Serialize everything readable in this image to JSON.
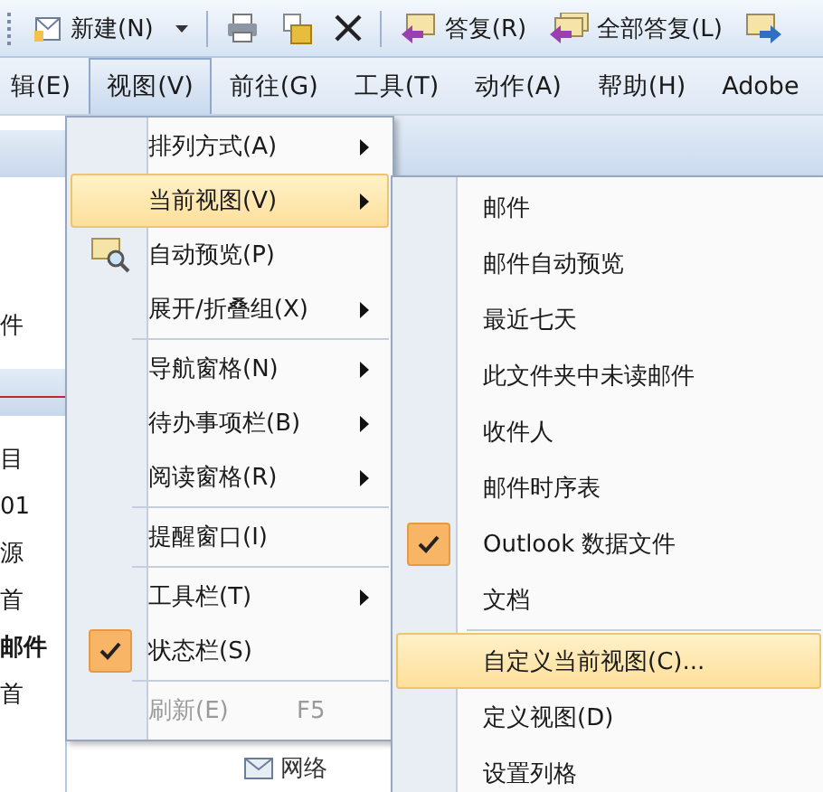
{
  "toolbar": {
    "buttons": [
      {
        "kind": "new",
        "label": "新建(N)"
      },
      {
        "kind": "dropdown"
      },
      {
        "kind": "print"
      },
      {
        "kind": "move"
      },
      {
        "kind": "delete"
      },
      {
        "kind": "reply",
        "label": "答复(R)"
      },
      {
        "kind": "reply_all",
        "label": "全部答复(L)"
      },
      {
        "kind": "forward"
      }
    ]
  },
  "menu_bar": {
    "items": [
      {
        "label": "辑(E)",
        "selected": false
      },
      {
        "label": "视图(V)",
        "selected": true
      },
      {
        "label": "前往(G)",
        "selected": false
      },
      {
        "label": "工具(T)",
        "selected": false
      },
      {
        "label": "动作(A)",
        "selected": false
      },
      {
        "label": "帮助(H)",
        "selected": false
      },
      {
        "label": "Adobe",
        "selected": false
      }
    ]
  },
  "left_pane": {
    "top_items": [
      "件"
    ],
    "items": [
      {
        "label": "目",
        "bold": false
      },
      {
        "label": "01",
        "bold": false
      },
      {
        "label": "源",
        "bold": false
      },
      {
        "label": "首",
        "bold": false
      },
      {
        "label": "邮件",
        "bold": true
      },
      {
        "label": "首",
        "bold": false
      }
    ]
  },
  "background_folder": {
    "label": "网络"
  },
  "view_menu": {
    "items": [
      {
        "kind": "item",
        "label": "排列方式(A)",
        "submenu": true,
        "selected": false,
        "checked": false,
        "disabled": false
      },
      {
        "kind": "item",
        "label": "当前视图(V)",
        "submenu": true,
        "selected": true,
        "checked": false,
        "disabled": false
      },
      {
        "kind": "item",
        "label": "自动预览(P)",
        "submenu": false,
        "selected": false,
        "checked": false,
        "disabled": false,
        "icon": true
      },
      {
        "kind": "item",
        "label": "展开/折叠组(X)",
        "submenu": true,
        "selected": false,
        "checked": false,
        "disabled": false
      },
      {
        "kind": "separator"
      },
      {
        "kind": "item",
        "label": "导航窗格(N)",
        "submenu": true,
        "selected": false,
        "checked": false,
        "disabled": false
      },
      {
        "kind": "item",
        "label": "待办事项栏(B)",
        "submenu": true,
        "selected": false,
        "checked": false,
        "disabled": false
      },
      {
        "kind": "item",
        "label": "阅读窗格(R)",
        "submenu": true,
        "selected": false,
        "checked": false,
        "disabled": false
      },
      {
        "kind": "separator"
      },
      {
        "kind": "item",
        "label": "提醒窗口(I)",
        "submenu": false,
        "selected": false,
        "checked": false,
        "disabled": false
      },
      {
        "kind": "separator"
      },
      {
        "kind": "item",
        "label": "工具栏(T)",
        "submenu": true,
        "selected": false,
        "checked": false,
        "disabled": false
      },
      {
        "kind": "item",
        "label": "状态栏(S)",
        "submenu": false,
        "selected": false,
        "checked": true,
        "disabled": false
      },
      {
        "kind": "separator"
      },
      {
        "kind": "item",
        "label": "刷新(E)",
        "shortcut": "F5",
        "submenu": false,
        "selected": false,
        "checked": false,
        "disabled": true
      }
    ]
  },
  "current_view_menu": {
    "items": [
      {
        "kind": "item",
        "label": "邮件",
        "selected": false,
        "checked": false
      },
      {
        "kind": "item",
        "label": "邮件自动预览",
        "selected": false,
        "checked": false
      },
      {
        "kind": "item",
        "label": "最近七天",
        "selected": false,
        "checked": false
      },
      {
        "kind": "item",
        "label": "此文件夹中未读邮件",
        "selected": false,
        "checked": false
      },
      {
        "kind": "item",
        "label": "收件人",
        "selected": false,
        "checked": false
      },
      {
        "kind": "item",
        "label": "邮件时序表",
        "selected": false,
        "checked": false
      },
      {
        "kind": "item",
        "label": "Outlook 数据文件",
        "selected": false,
        "checked": true
      },
      {
        "kind": "item",
        "label": "文档",
        "selected": false,
        "checked": false
      },
      {
        "kind": "separator"
      },
      {
        "kind": "item",
        "label": "自定义当前视图(C)...",
        "selected": true,
        "checked": false
      },
      {
        "kind": "item",
        "label": "定义视图(D)",
        "selected": false,
        "checked": false
      },
      {
        "kind": "item",
        "label": "设置列格",
        "selected": false,
        "checked": false
      }
    ]
  }
}
